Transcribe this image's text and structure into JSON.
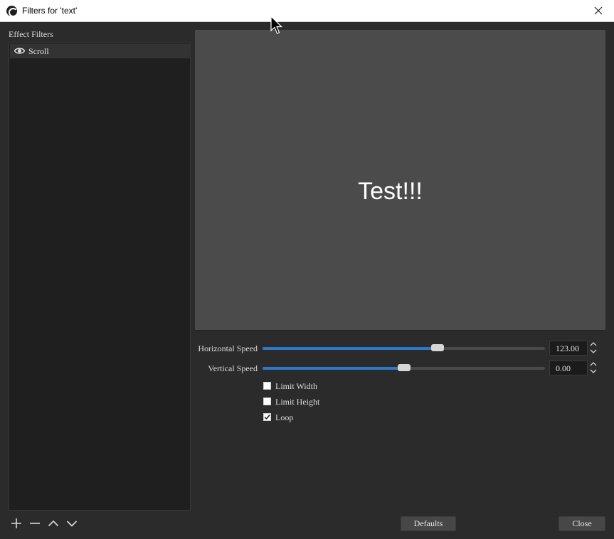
{
  "window": {
    "title": "Filters for 'text'",
    "icon": "obs-logo-icon",
    "close_icon": "close-icon"
  },
  "filters_panel": {
    "label": "Effect Filters",
    "items": [
      {
        "label": "Scroll",
        "visible_icon": "eye-icon",
        "selected": true
      }
    ],
    "buttons": [
      {
        "name": "add-filter-button",
        "icon": "plus-icon"
      },
      {
        "name": "remove-filter-button",
        "icon": "minus-icon"
      },
      {
        "name": "move-up-button",
        "icon": "chevron-up-icon"
      },
      {
        "name": "move-down-button",
        "icon": "chevron-down-icon"
      }
    ]
  },
  "preview": {
    "text": "Test!!!"
  },
  "properties": {
    "horizontal_speed": {
      "label": "Horizontal Speed",
      "value": "123.00",
      "slider_fraction": 0.62
    },
    "vertical_speed": {
      "label": "Vertical Speed",
      "value": "0.00",
      "slider_fraction": 0.5
    },
    "limit_width": {
      "label": "Limit Width",
      "checked": false
    },
    "limit_height": {
      "label": "Limit Height",
      "checked": false
    },
    "loop": {
      "label": "Loop",
      "checked": true
    }
  },
  "footer": {
    "defaults_label": "Defaults",
    "close_label": "Close"
  },
  "colors": {
    "accent": "#2f78c8",
    "background": "#2b2b2b",
    "preview_bg": "#4b4b4b"
  }
}
